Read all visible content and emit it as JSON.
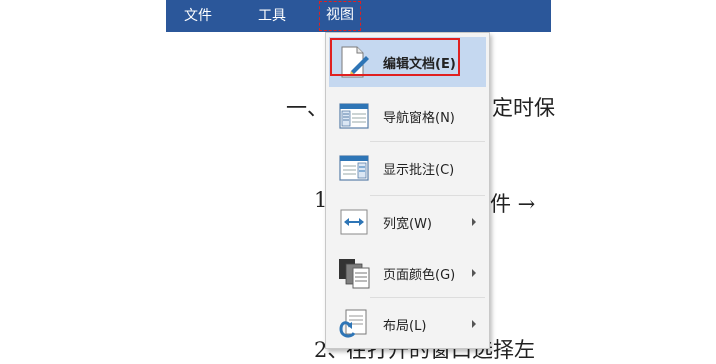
{
  "menubar": {
    "items": [
      {
        "label": "文件"
      },
      {
        "label": "工具"
      },
      {
        "label": "视图"
      }
    ]
  },
  "document": {
    "line1_prefix": "一、",
    "line1_tail": "定时保",
    "line2_prefix": "1",
    "line2_tail": "件 →",
    "line3_prefix": "2、",
    "line3_tail": "在打开的窗口选择左"
  },
  "view_menu": {
    "items": [
      {
        "label": "编辑文档(E)",
        "icon": "edit-document-icon",
        "has_submenu": false
      },
      {
        "label": "导航窗格(N)",
        "icon": "navigation-pane-icon",
        "has_submenu": false
      },
      {
        "label": "显示批注(C)",
        "icon": "show-comments-icon",
        "has_submenu": false
      },
      {
        "label": "列宽(W)",
        "icon": "column-width-icon",
        "has_submenu": true
      },
      {
        "label": "页面颜色(G)",
        "icon": "page-color-icon",
        "has_submenu": true
      },
      {
        "label": "布局(L)",
        "icon": "layout-icon",
        "has_submenu": true
      }
    ]
  },
  "colors": {
    "menubar_bg": "#2b579a",
    "highlight_bg": "#c5d8f0",
    "annotation_red": "#e02020",
    "icon_blue": "#2e75b6"
  }
}
